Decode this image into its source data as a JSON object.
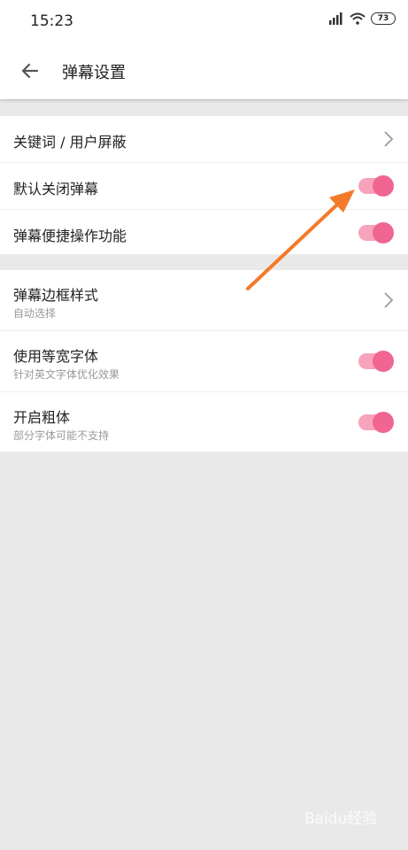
{
  "status_bar": {
    "time": "15:23",
    "battery": "73"
  },
  "toolbar": {
    "title": "弹幕设置",
    "back_icon": "arrow-left-icon"
  },
  "group1": [
    {
      "label": "关键词 / 用户屏蔽",
      "control": "chevron"
    },
    {
      "label": "默认关闭弹幕",
      "control": "toggle",
      "on": true
    },
    {
      "label": "弹幕便捷操作功能",
      "control": "toggle",
      "on": true
    }
  ],
  "group2": [
    {
      "label": "弹幕边框样式",
      "sub": "自动选择",
      "control": "chevron"
    },
    {
      "label": "使用等宽字体",
      "sub": "针对英文字体优化效果",
      "control": "toggle",
      "on": true
    },
    {
      "label": "开启粗体",
      "sub": "部分字体可能不支持",
      "control": "toggle",
      "on": true
    }
  ],
  "colors": {
    "accent": "#f06592",
    "track": "#f6a3bb",
    "annotation_arrow": "#f47a2a"
  },
  "watermark": "Baidu经验"
}
